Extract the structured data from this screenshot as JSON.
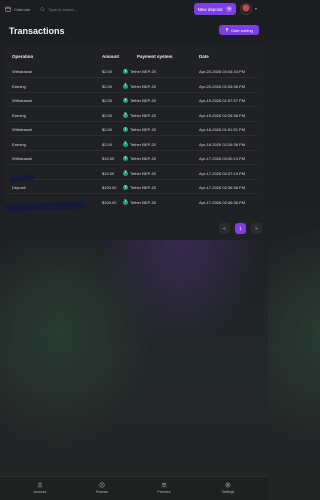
{
  "topbar": {
    "calendar_label": "Calendar",
    "search_placeholder": "Type to search...",
    "new_deposit_label": "New deposit",
    "new_deposit_plus": "+"
  },
  "page": {
    "title": "Transactions",
    "sort_label": "Date sorting"
  },
  "table": {
    "headers": [
      "Operation",
      "Amount",
      "Payment system",
      "Date"
    ],
    "rows": [
      {
        "operation": "Withdrawal",
        "amount": "$2.00",
        "payment": "Tether BEP-20",
        "date": "Apr-20-2026 03:44:34 PM"
      },
      {
        "operation": "Earning",
        "amount": "$2.00",
        "payment": "Tether BEP-20",
        "date": "Apr-20-2026 02:26:36 PM"
      },
      {
        "operation": "Withdrawal",
        "amount": "$2.00",
        "payment": "Tether BEP-20",
        "date": "Apr-19-2026 01:57:57 PM"
      },
      {
        "operation": "Earning",
        "amount": "$2.00",
        "payment": "Tether BEP-20",
        "date": "Apr-19-2026 02:26:36 PM"
      },
      {
        "operation": "Withdrawal",
        "amount": "$2.00",
        "payment": "Tether BEP-20",
        "date": "Apr-18-2026 01:51:51 PM"
      },
      {
        "operation": "Earning",
        "amount": "$2.00",
        "payment": "Tether BEP-20",
        "date": "Apr-18-2026 02:26:36 PM"
      },
      {
        "operation": "Withdrawal",
        "amount": "$10.00",
        "payment": "Tether BEP-20",
        "date": "Apr-17-2026 03:30:13 PM"
      },
      {
        "operation": "",
        "amount": "$10.00",
        "payment": "Tether BEP-20",
        "date": "Apr-17-2026 02:37:15 PM"
      },
      {
        "operation": "Deposit",
        "amount": "$100.00",
        "payment": "Tether BEP-20",
        "date": "Apr-17-2026 02:36:36 PM"
      },
      {
        "operation": "",
        "amount": "$100.00",
        "payment": "Tether BEP-20",
        "date": "Apr-17-2026 02:36:36 PM"
      }
    ]
  },
  "pagination": {
    "prev": "<",
    "current": "1",
    "next": ">"
  },
  "bottom_nav": {
    "items": [
      {
        "label": "Account",
        "icon": "user-icon"
      },
      {
        "label": "Finance",
        "icon": "wallet-icon"
      },
      {
        "label": "Partners",
        "icon": "users-icon"
      },
      {
        "label": "Settings",
        "icon": "gear-icon"
      }
    ]
  },
  "colors": {
    "accent": "#7b3fe4",
    "tether": "#26a17b",
    "card": "#202125"
  }
}
